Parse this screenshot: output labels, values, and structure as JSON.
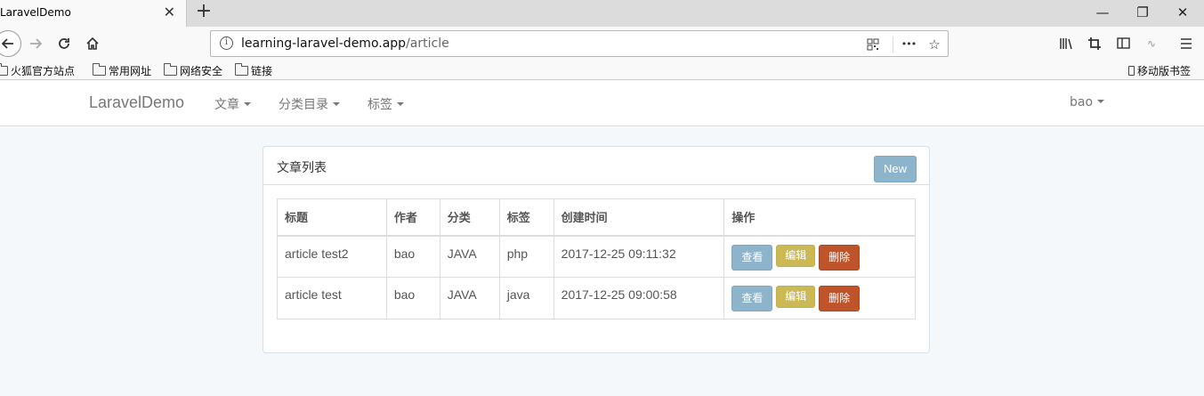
{
  "browser": {
    "tab_title": "LaravelDemo",
    "tab_close": "✕",
    "new_tab": "+",
    "window_min": "—",
    "window_restore": "❐",
    "window_close": "✕",
    "url_host": "learning-laravel-demo.app",
    "url_path": "/article",
    "url_info": "i",
    "page_actions": "•••",
    "bookmarks": [
      "火狐官方站点",
      "常用网址",
      "网络安全",
      "链接"
    ],
    "mobile_bookmarks": "移动版书签"
  },
  "app": {
    "brand": "LaravelDemo",
    "menus": [
      "文章",
      "分类目录",
      "标签"
    ],
    "user": "bao"
  },
  "panel": {
    "title": "文章列表",
    "new_button": "New",
    "columns": [
      "标题",
      "作者",
      "分类",
      "标签",
      "创建时间",
      "操作"
    ],
    "rows": [
      {
        "title": "article test2",
        "author": "bao",
        "category": "JAVA",
        "tag": "php",
        "created": "2017-12-25 09:11:32"
      },
      {
        "title": "article test",
        "author": "bao",
        "category": "JAVA",
        "tag": "java",
        "created": "2017-12-25 09:00:58"
      }
    ],
    "actions": {
      "view": "查看",
      "edit": "编辑",
      "delete": "删除"
    }
  },
  "colors": {
    "view": "#8eb4cb",
    "edit": "#cbb956",
    "delete": "#bf5329",
    "page_bg": "#f5f8fa"
  }
}
